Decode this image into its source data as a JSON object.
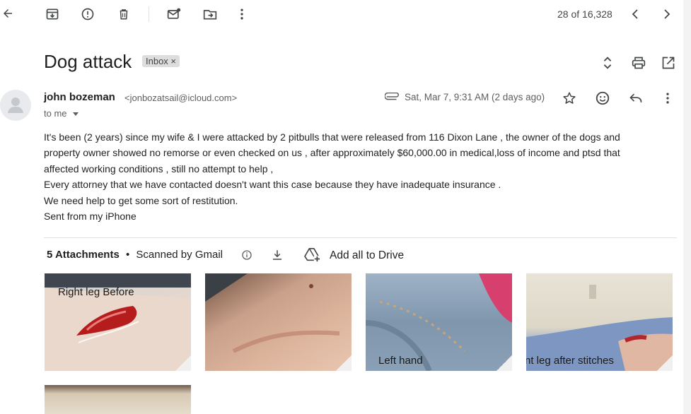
{
  "toolbar": {
    "count": "28 of 16,328"
  },
  "message": {
    "subject": "Dog attack",
    "label": "Inbox ×",
    "sender_name": "john bozeman",
    "sender_email": "<jonbozatsail@icloud.com>",
    "to": "to me",
    "date": "Sat, Mar 7, 9:31 AM (2 days ago)",
    "body": [
      "It's been (2 years) since my wife & I were attacked by 2 pitbulls that were  released from 116 Dixon Lane , the owner of the dogs and",
      "property owner showed no remorse or even checked on us , after approximately $60,000.00 in medical,loss of income and ptsd that",
      "affected working conditions , still no attempt to help ,",
      "Every attorney that we have contacted doesn't want this case because they have inadequate insurance .",
      "We need help to get some sort of restitution.",
      "Sent from my iPhone"
    ]
  },
  "attachments": {
    "count_label": "5 Attachments",
    "separator": "•",
    "scanned": "Scanned by Gmail",
    "add_drive": "Add all to Drive",
    "captions": [
      "Right leg Before",
      "",
      "Left hand",
      "nt leg after stitches",
      ""
    ]
  },
  "icons": [
    "back-arrow-icon",
    "archive-icon",
    "report-spam-icon",
    "delete-icon",
    "mark-unread-icon",
    "move-to-icon",
    "more-vert-icon",
    "chevron-left-icon",
    "chevron-right-icon",
    "expand-icon",
    "print-icon",
    "open-new-window-icon",
    "attachment-clip-icon",
    "star-icon",
    "emoji-icon",
    "reply-icon",
    "info-icon",
    "download-icon",
    "add-to-drive-icon"
  ]
}
